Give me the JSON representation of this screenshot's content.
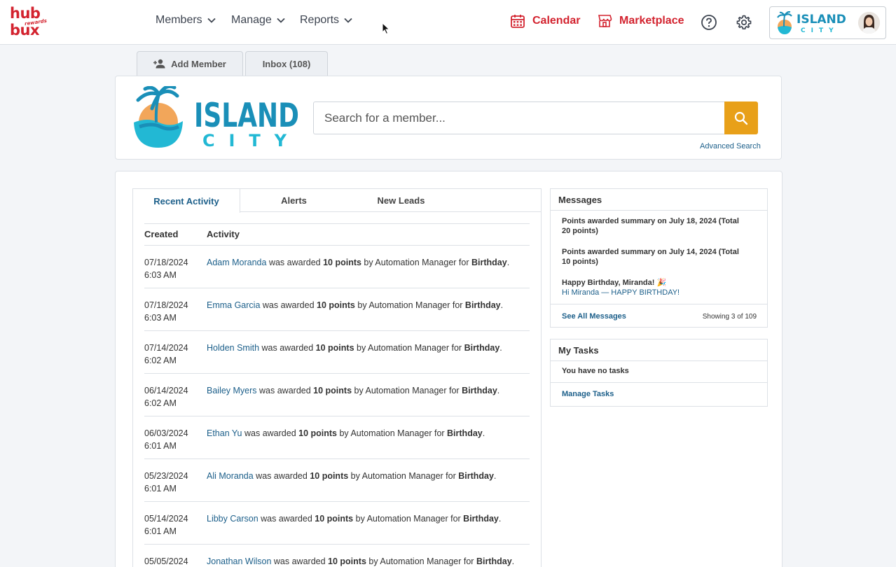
{
  "brand": {
    "line1": "hub",
    "line2": "bux",
    "sub": "rewards"
  },
  "nav": {
    "members": "Members",
    "manage": "Manage",
    "reports": "Reports"
  },
  "header": {
    "calendar": "Calendar",
    "marketplace": "Marketplace",
    "calendar_color": "#d3232f",
    "marketplace_color": "#d3232f"
  },
  "account": {
    "logo_top": "ISLAND",
    "logo_bottom": "CITY"
  },
  "tabs_top": {
    "add_member": "Add Member",
    "inbox": "Inbox (108)"
  },
  "org_logo": {
    "top": "ISLAND",
    "bottom": "CITY"
  },
  "search": {
    "placeholder": "Search for a member...",
    "advanced": "Advanced Search",
    "button_color": "#e8a019"
  },
  "activity": {
    "tabs": [
      "Recent Activity",
      "Alerts",
      "New Leads"
    ],
    "columns": [
      "Created",
      "Activity"
    ],
    "rows": [
      {
        "date": "07/18/2024",
        "time": "6:03 AM",
        "name": "Adam Moranda",
        "mid": " was awarded ",
        "points": "10 points",
        "by": " by Automation Manager for ",
        "reason": "Birthday",
        "end": "."
      },
      {
        "date": "07/18/2024",
        "time": "6:03 AM",
        "name": "Emma Garcia",
        "mid": " was awarded ",
        "points": "10 points",
        "by": " by Automation Manager for ",
        "reason": "Birthday",
        "end": "."
      },
      {
        "date": "07/14/2024",
        "time": "6:02 AM",
        "name": "Holden Smith",
        "mid": " was awarded ",
        "points": "10 points",
        "by": " by Automation Manager for ",
        "reason": "Birthday",
        "end": "."
      },
      {
        "date": "06/14/2024",
        "time": "6:02 AM",
        "name": "Bailey Myers",
        "mid": " was awarded ",
        "points": "10 points",
        "by": " by Automation Manager for ",
        "reason": "Birthday",
        "end": "."
      },
      {
        "date": "06/03/2024",
        "time": "6:01 AM",
        "name": "Ethan Yu",
        "mid": " was awarded ",
        "points": "10 points",
        "by": " by Automation Manager for ",
        "reason": "Birthday",
        "end": "."
      },
      {
        "date": "05/23/2024",
        "time": "6:01 AM",
        "name": "Ali Moranda",
        "mid": " was awarded ",
        "points": "10 points",
        "by": " by Automation Manager for ",
        "reason": "Birthday",
        "end": "."
      },
      {
        "date": "05/14/2024",
        "time": "6:01 AM",
        "name": "Libby Carson",
        "mid": " was awarded ",
        "points": "10 points",
        "by": " by Automation Manager for ",
        "reason": "Birthday",
        "end": "."
      },
      {
        "date": "05/05/2024",
        "time": "",
        "name": "Jonathan Wilson",
        "mid": " was awarded ",
        "points": "10 points",
        "by": " by Automation Manager for ",
        "reason": "Birthday",
        "end": "."
      }
    ]
  },
  "messages": {
    "title": "Messages",
    "items": [
      {
        "line1": "Points awarded summary on July 18, 2024 (Total",
        "line2": "20 points)"
      },
      {
        "line1": "Points awarded summary on July 14, 2024 (Total",
        "line2": "10 points)"
      },
      {
        "line1": "Happy Birthday, Miranda! 🎉",
        "line2": "Hi Miranda — HAPPY BIRTHDAY!"
      }
    ],
    "see_all": "See All Messages",
    "showing": "Showing 3 of 109"
  },
  "tasks": {
    "title": "My Tasks",
    "empty": "You have no tasks",
    "manage": "Manage Tasks"
  }
}
